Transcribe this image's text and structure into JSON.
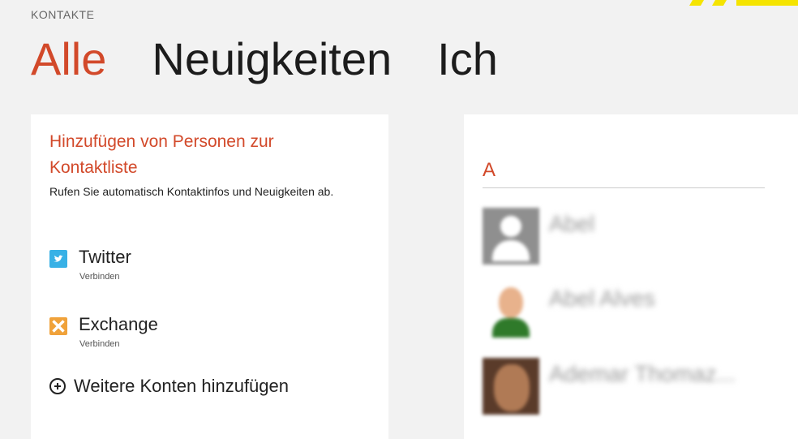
{
  "app": {
    "title": "KONTAKTE"
  },
  "pivot": [
    {
      "label": "Alle",
      "active": true
    },
    {
      "label": "Neuigkeiten",
      "active": false
    },
    {
      "label": "Ich",
      "active": false
    }
  ],
  "add_panel": {
    "heading": "Hinzufügen von Personen zur Kontaktliste",
    "description": "Rufen Sie automatisch Kontaktinfos und Neuigkeiten ab.",
    "accounts": [
      {
        "name": "Twitter",
        "action": "Verbinden",
        "icon": "twitter-icon"
      },
      {
        "name": "Exchange",
        "action": "Verbinden",
        "icon": "exchange-icon"
      }
    ],
    "add_more": {
      "label": "Weitere Konten hinzufügen",
      "icon": "add-circle-icon"
    }
  },
  "contacts_panel": {
    "group_letter": "A",
    "contacts": [
      {
        "name": "Abel"
      },
      {
        "name": "Abel Alves"
      },
      {
        "name": "Ademar Thomaz..."
      }
    ]
  },
  "colors": {
    "accent": "#d2492a",
    "background": "#f2f2f2",
    "panel": "#ffffff",
    "twitter": "#38b1e6",
    "exchange": "#f0a23a",
    "top_accent": "#f5e400"
  }
}
